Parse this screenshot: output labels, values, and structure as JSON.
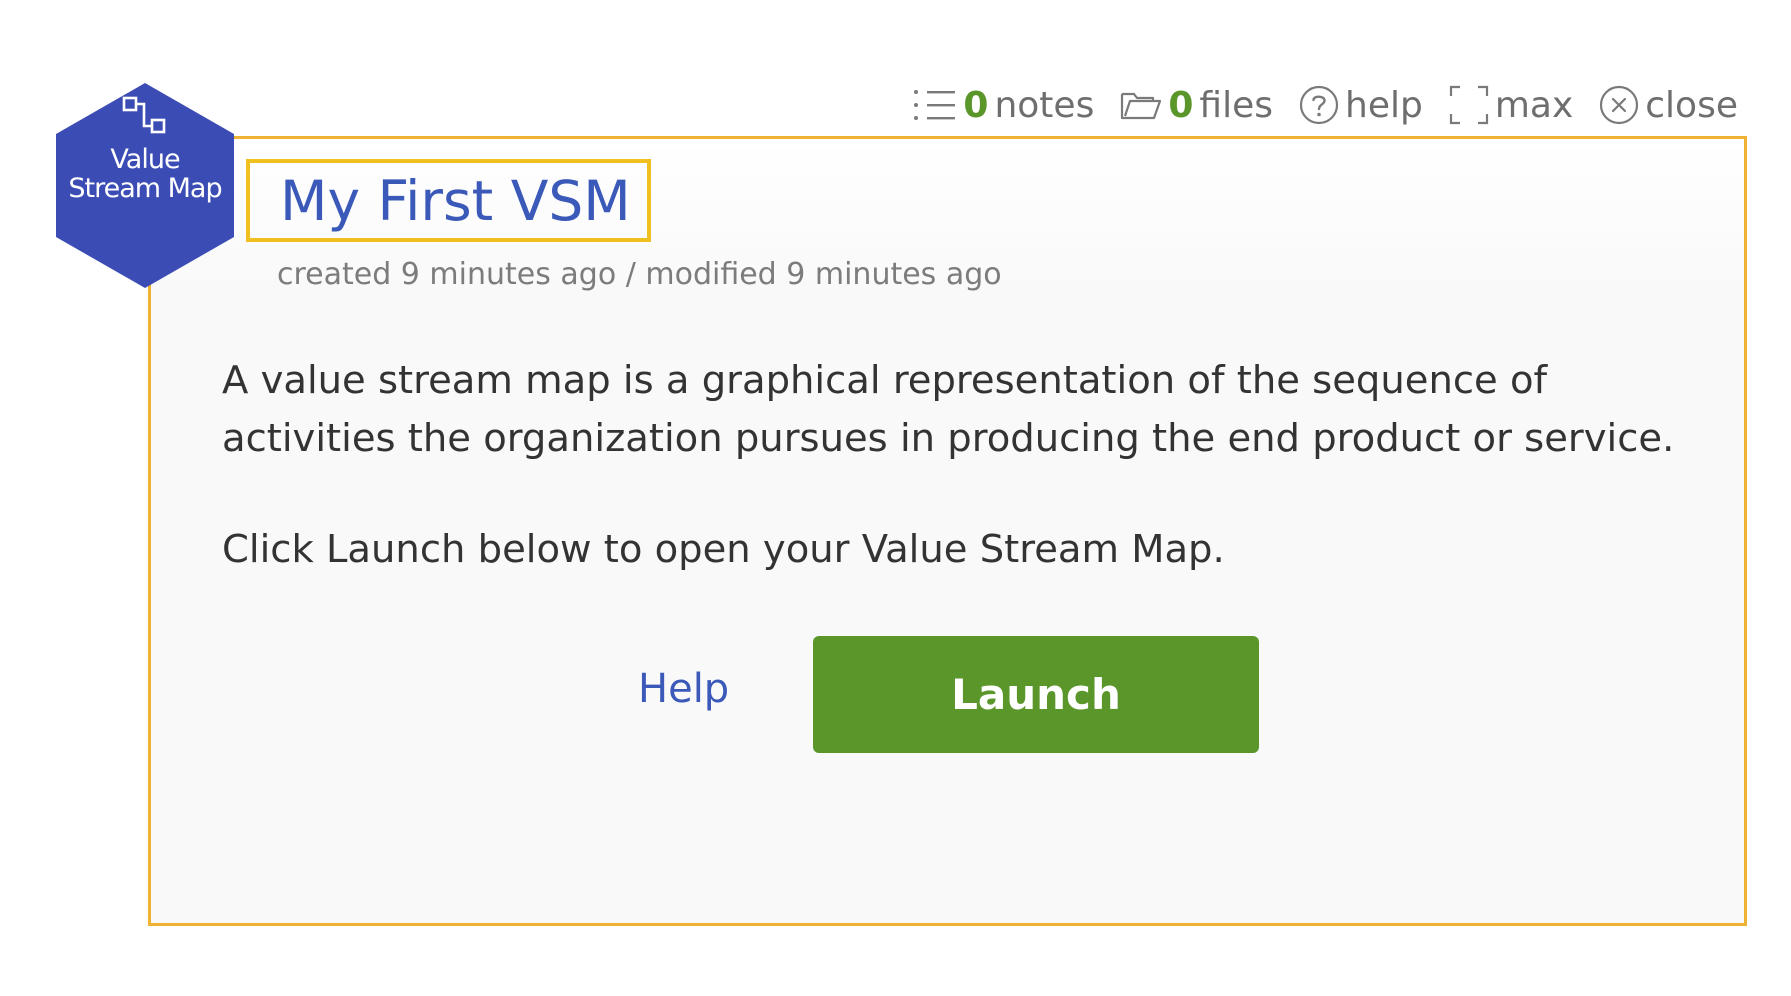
{
  "toolbar": {
    "notes": {
      "count": "0",
      "label": "notes",
      "icon": "list-icon"
    },
    "files": {
      "count": "0",
      "label": "files",
      "icon": "folder-icon"
    },
    "help": {
      "label": "help",
      "icon": "help-circle-icon"
    },
    "max": {
      "label": "max",
      "icon": "maximize-icon"
    },
    "close": {
      "label": "close",
      "icon": "close-circle-icon"
    }
  },
  "badge": {
    "line1": "Value",
    "line2": "Stream Map",
    "icon": "value-stream-icon",
    "color": "#3b4db4"
  },
  "panel": {
    "title": "My First VSM",
    "meta": "created 9 minutes ago / modified 9 minutes ago",
    "description": "A value stream map is a graphical representation of the sequence of activities the organization pursues in producing the end product or service.",
    "instruction": "Click Launch below to open your Value Stream Map.",
    "border_color": "#f0b232"
  },
  "actions": {
    "help_label": "Help",
    "launch_label": "Launch",
    "launch_color": "#5a962a",
    "link_color": "#3a59b8"
  }
}
